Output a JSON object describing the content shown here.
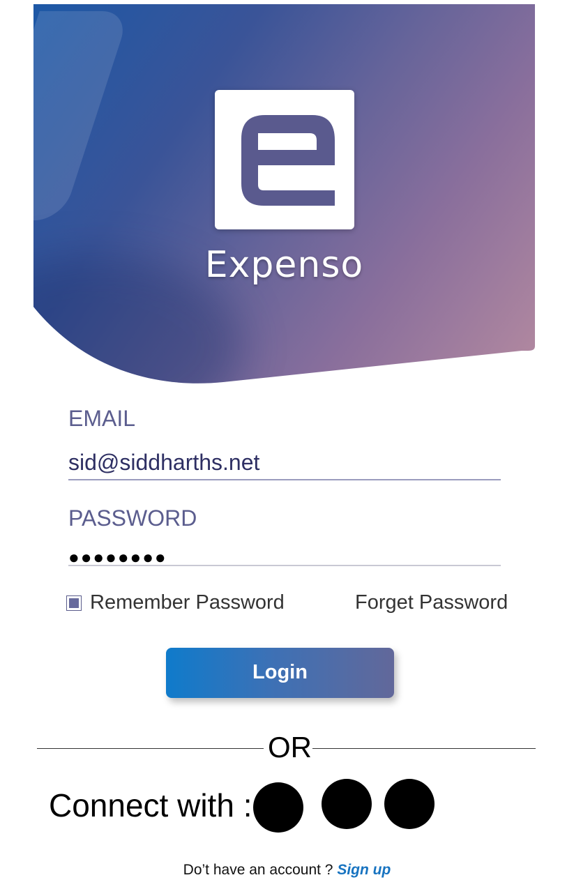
{
  "app": {
    "name": "Expenso",
    "logo": "e-logo-icon"
  },
  "colors": {
    "primary": "#5b5d8e",
    "accent": "#1773c0",
    "hero_start": "#1d58a6",
    "hero_end": "#b48aa0"
  },
  "form": {
    "email_label": "EMAIL",
    "email_value": "sid@siddharths.net",
    "password_label": "PASSWORD",
    "password_value": "●●●●●●●●",
    "remember_label": "Remember Password",
    "remember_checked": true,
    "forgot_label": "Forget Password",
    "login_label": "Login"
  },
  "divider": {
    "text": "OR"
  },
  "social": {
    "label": "Connect with :",
    "buttons": [
      "social-icon-1",
      "social-icon-2",
      "social-icon-3"
    ]
  },
  "footer": {
    "prompt": "Do’t have an account ?",
    "signup_label": "Sign up"
  }
}
